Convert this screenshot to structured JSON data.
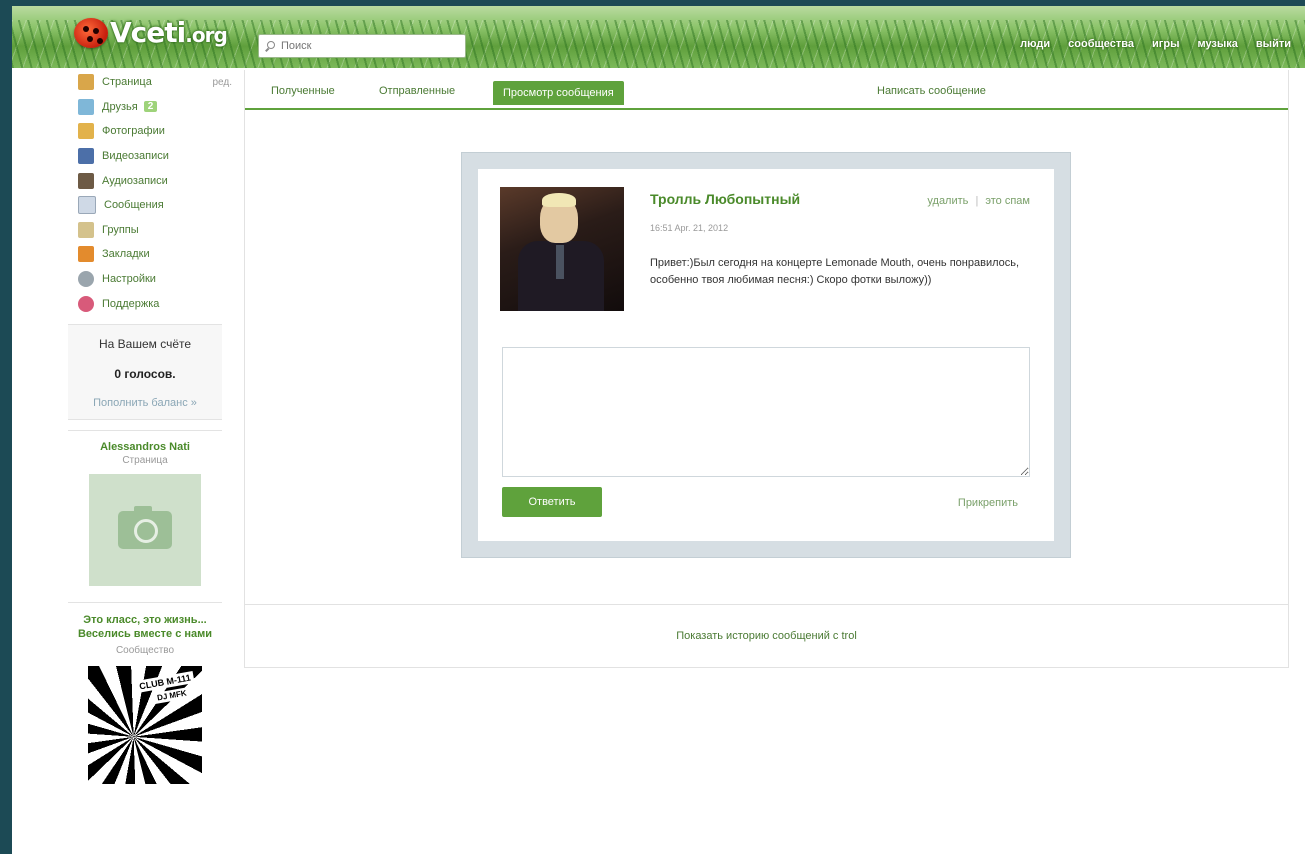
{
  "app": {
    "logo_text": "Vceti",
    "logo_suffix": ".org"
  },
  "search": {
    "placeholder": "Поиск"
  },
  "topnav": [
    "люди",
    "сообщества",
    "игры",
    "музыка",
    "выйти"
  ],
  "sidebar": {
    "items": [
      {
        "label": "Страница",
        "icon": "home-icon",
        "color": "#d9a64a"
      },
      {
        "label": "Друзья",
        "icon": "friends-icon",
        "color": "#7fb7d8"
      },
      {
        "label": "Фотографии",
        "icon": "photos-icon",
        "color": "#e2b24b"
      },
      {
        "label": "Видеозаписи",
        "icon": "video-icon",
        "color": "#4c6fa8"
      },
      {
        "label": "Аудиозаписи",
        "icon": "audio-icon",
        "color": "#6d5a45"
      },
      {
        "label": "Сообщения",
        "icon": "mail-icon",
        "color": "#cfd9e6"
      },
      {
        "label": "Группы",
        "icon": "groups-icon",
        "color": "#d4c28c"
      },
      {
        "label": "Закладки",
        "icon": "bookmarks-icon",
        "color": "#e38b2d"
      },
      {
        "label": "Настройки",
        "icon": "settings-icon",
        "color": "#9aa5ad"
      },
      {
        "label": "Поддержка",
        "icon": "support-icon",
        "color": "#d85a7a"
      }
    ],
    "edit_label": "ред.",
    "friends_badge": "2"
  },
  "balance": {
    "title": "На Вашем счёте",
    "votes": "0 голосов.",
    "topup": "Пополнить баланс »"
  },
  "profile": {
    "name": "Alessandros Nati",
    "sub": "Страница"
  },
  "community": {
    "name": "Это класс, это жизнь... Веселись вместе с нами",
    "sub": "Сообщество",
    "poster_line1": "CLUB M-111",
    "poster_line2": "DJ MFK"
  },
  "tabs": {
    "inbox": "Полученные",
    "sent": "Отправленные",
    "view": "Просмотр сообщения",
    "write": "Написать сообщение"
  },
  "message": {
    "sender": "Тролль Любопытный",
    "delete": "удалить",
    "separator": "|",
    "spam": "это спам",
    "date": "16:51 Apr. 21, 2012",
    "text": "Привет:)Был сегодня на концерте Lemonade Mouth, очень понравилось, особенно твоя любимая песня:) Скоро фотки выложу))",
    "reply_button": "Ответить",
    "attach": "Прикрепить"
  },
  "history_link": "Показать историю сообщений с trol",
  "colors": {
    "accent": "#5fa23c",
    "link": "#4a7a33",
    "frame": "#1c4a55"
  }
}
